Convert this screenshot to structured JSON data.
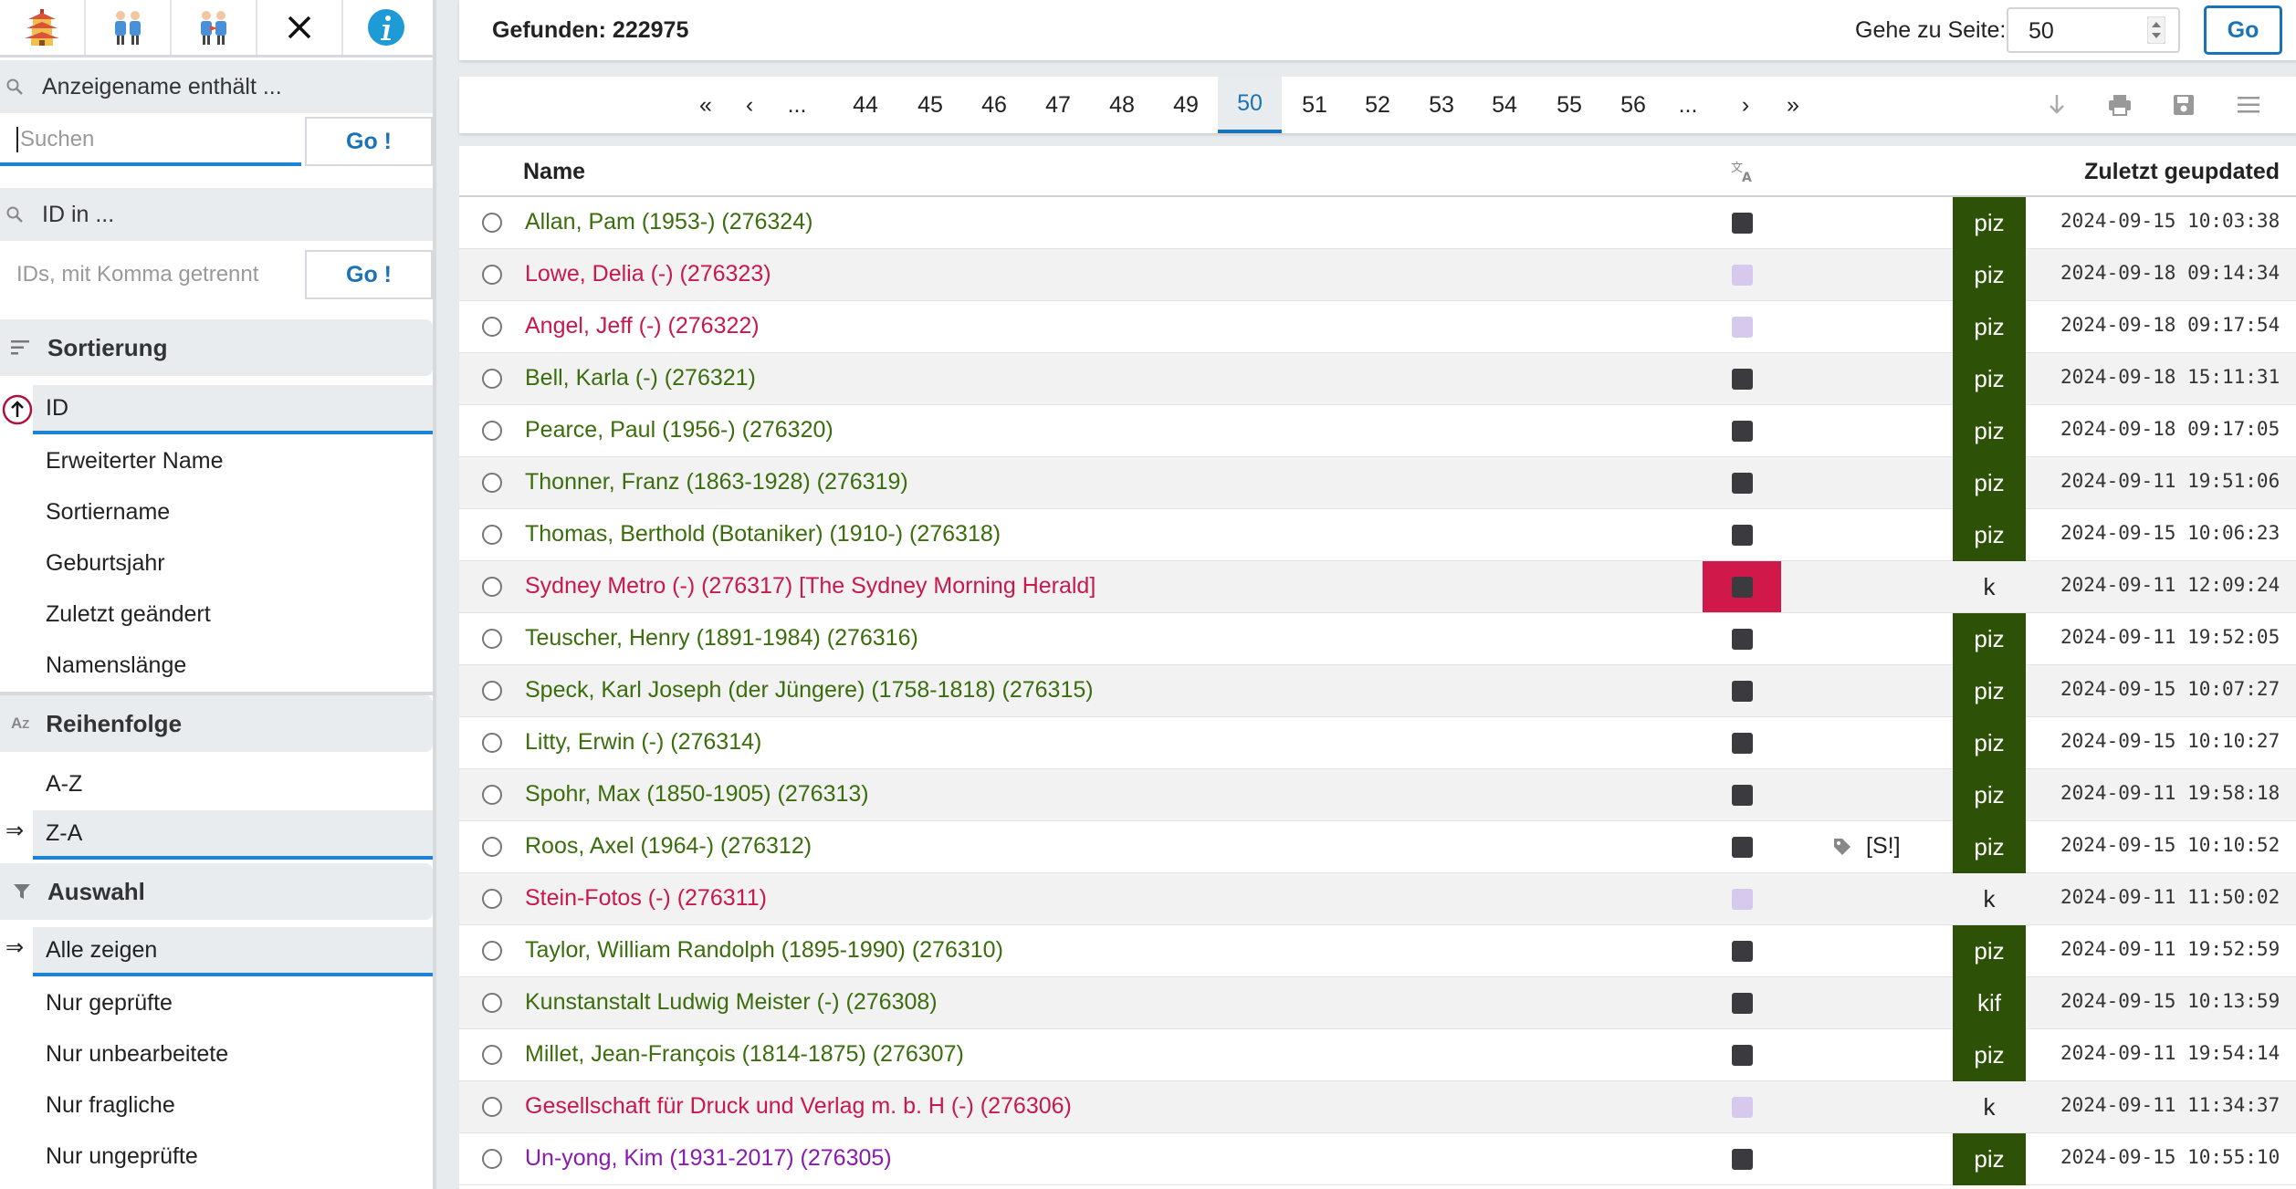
{
  "toolbar": {
    "icons": [
      "pagoda-icon",
      "people-icon",
      "people-arrows-icon",
      "close-icon",
      "info-icon"
    ]
  },
  "sidebar": {
    "name_filter_label": "Anzeigename enthält ...",
    "search_placeholder": "Suchen",
    "go_label": "Go !",
    "id_filter_label": "ID in ...",
    "ids_placeholder": "IDs, mit Komma getrennt",
    "go2_label": "Go !",
    "sort": {
      "title": "Sortierung",
      "options": [
        {
          "label": "ID",
          "active": true
        },
        {
          "label": "Erweiterter Name"
        },
        {
          "label": "Sortiername"
        },
        {
          "label": "Geburtsjahr"
        },
        {
          "label": "Zuletzt geändert"
        },
        {
          "label": "Namenslänge"
        }
      ]
    },
    "order": {
      "title": "Reihenfolge",
      "options": [
        {
          "label": "A-Z"
        },
        {
          "label": "Z-A",
          "active": true
        }
      ]
    },
    "selection": {
      "title": "Auswahl",
      "options": [
        {
          "label": "Alle zeigen",
          "active": true
        },
        {
          "label": "Nur geprüfte"
        },
        {
          "label": "Nur unbearbeitete"
        },
        {
          "label": "Nur fragliche"
        },
        {
          "label": "Nur ungeprüfte"
        }
      ]
    },
    "active_marker": "⇒"
  },
  "topbar": {
    "found": "Gefunden: 222975",
    "goto_label": "Gehe zu Seite:",
    "goto_value": "50",
    "go_label": "Go"
  },
  "pagination": {
    "items": [
      "«",
      "‹",
      "...",
      "44",
      "45",
      "46",
      "47",
      "48",
      "49",
      "50",
      "51",
      "52",
      "53",
      "54",
      "55",
      "56",
      "...",
      "›",
      "»"
    ],
    "current": "50"
  },
  "table": {
    "col_name": "Name",
    "col_updated": "Zuletzt geupdated",
    "colors": {
      "green": "#3a6d0c",
      "red": "#c8184e",
      "purple": "#8a1ab0",
      "status_bg": "#2d5107",
      "highlight": "#d0184a"
    },
    "rows": [
      {
        "name": "Allan, Pam (1953-) (276324)",
        "color": "green",
        "square": "dark",
        "status": "piz",
        "date": "2024-09-15 10:03:38"
      },
      {
        "name": "Lowe, Delia (-) (276323)",
        "color": "red",
        "square": "lilac",
        "status": "piz",
        "date": "2024-09-18 09:14:34"
      },
      {
        "name": "Angel, Jeff (-) (276322)",
        "color": "red",
        "square": "lilac",
        "status": "piz",
        "date": "2024-09-18 09:17:54"
      },
      {
        "name": "Bell, Karla (-) (276321)",
        "color": "green",
        "square": "dark",
        "status": "piz",
        "date": "2024-09-18 15:11:31"
      },
      {
        "name": "Pearce, Paul (1956-) (276320)",
        "color": "green",
        "square": "dark",
        "status": "piz",
        "date": "2024-09-18 09:17:05"
      },
      {
        "name": "Thonner, Franz (1863-1928) (276319)",
        "color": "green",
        "square": "dark",
        "status": "piz",
        "date": "2024-09-11 19:51:06"
      },
      {
        "name": "Thomas, Berthold (Botaniker) (1910-) (276318)",
        "color": "green",
        "square": "dark",
        "status": "piz",
        "date": "2024-09-15 10:06:23"
      },
      {
        "name": "Sydney Metro (-) (276317) [The Sydney Morning Herald]",
        "color": "red",
        "square": "dark",
        "highlight": true,
        "status": "k",
        "date": "2024-09-11 12:09:24"
      },
      {
        "name": "Teuscher, Henry (1891-1984) (276316)",
        "color": "green",
        "square": "dark",
        "status": "piz",
        "date": "2024-09-11 19:52:05"
      },
      {
        "name": "Speck, Karl Joseph (der Jüngere) (1758-1818) (276315)",
        "color": "green",
        "square": "dark",
        "status": "piz",
        "date": "2024-09-15 10:07:27"
      },
      {
        "name": "Litty, Erwin (-) (276314)",
        "color": "green",
        "square": "dark",
        "status": "piz",
        "date": "2024-09-15 10:10:27"
      },
      {
        "name": "Spohr, Max (1850-1905) (276313)",
        "color": "green",
        "square": "dark",
        "status": "piz",
        "date": "2024-09-11 19:58:18"
      },
      {
        "name": "Roos, Axel (1964-) (276312)",
        "color": "green",
        "square": "dark",
        "tag": "[S!]",
        "status": "piz",
        "date": "2024-09-15 10:10:52"
      },
      {
        "name": "Stein-Fotos (-) (276311)",
        "color": "red",
        "square": "lilac",
        "status": "k",
        "date": "2024-09-11 11:50:02"
      },
      {
        "name": "Taylor, William Randolph (1895-1990) (276310)",
        "color": "green",
        "square": "dark",
        "status": "piz",
        "date": "2024-09-11 19:52:59"
      },
      {
        "name": "Kunstanstalt Ludwig Meister (-) (276308)",
        "color": "green",
        "square": "dark",
        "status": "kif",
        "date": "2024-09-15 10:13:59"
      },
      {
        "name": "Millet, Jean-François (1814-1875) (276307)",
        "color": "green",
        "square": "dark",
        "status": "piz",
        "date": "2024-09-11 19:54:14"
      },
      {
        "name": "Gesellschaft für Druck und Verlag m. b. H (-) (276306)",
        "color": "red",
        "square": "lilac",
        "status": "k",
        "date": "2024-09-11 11:34:37"
      },
      {
        "name": "Un-yong, Kim (1931-2017) (276305)",
        "color": "purple",
        "square": "dark",
        "status": "piz",
        "date": "2024-09-15 10:55:10"
      }
    ]
  }
}
